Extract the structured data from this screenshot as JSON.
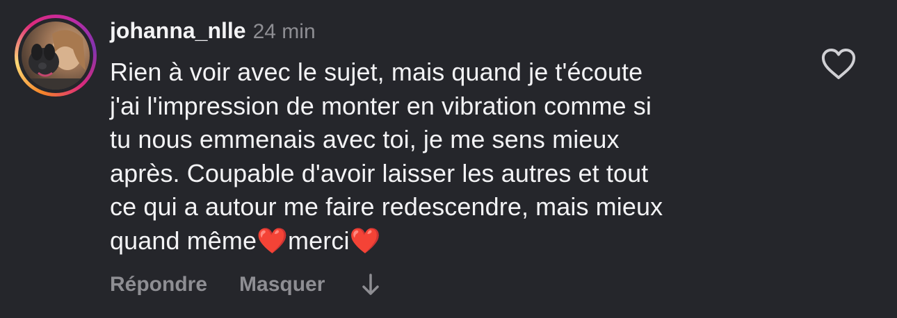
{
  "comment": {
    "username": "johanna_nlle",
    "timestamp": "24 min",
    "text": "Rien à voir avec le sujet, mais quand je t'écoute\nj'ai l'impression de monter en vibration comme si\ntu nous emmenais avec toi, je me sens mieux\naprès. Coupable d'avoir laisser les autres et tout\nce qui a autour me faire redescendre, mais mieux\nquand même❤️merci❤️"
  },
  "actions": {
    "reply_label": "Répondre",
    "hide_label": "Masquer"
  },
  "icons": {
    "like": "heart-outline-icon",
    "more": "arrow-down-icon"
  },
  "colors": {
    "background": "#25262b",
    "text_primary": "#f3f3f5",
    "text_secondary": "#8e8e93",
    "story_ring_start": "#f58529",
    "story_ring_end": "#c32aa3"
  }
}
